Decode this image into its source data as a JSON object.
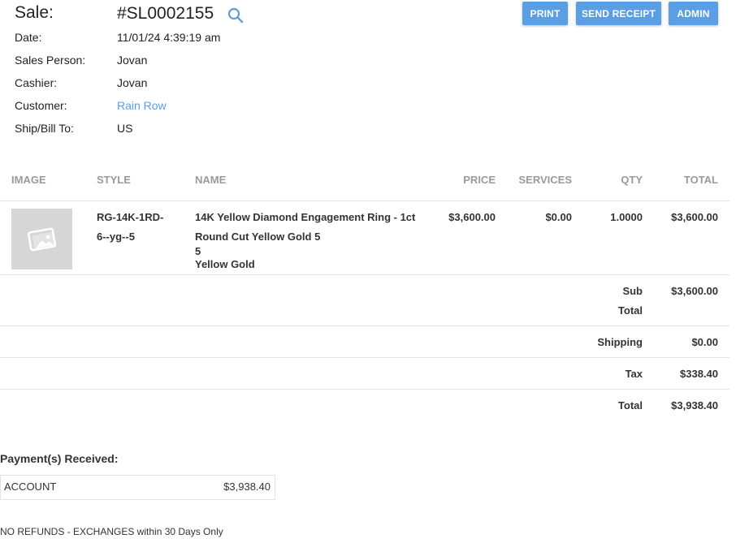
{
  "header": {
    "sale_label": "Sale:",
    "sale_number": "#SL0002155",
    "search_icon": "search-icon"
  },
  "info": {
    "date_label": "Date:",
    "date_value": "11/01/24 4:39:19 am",
    "sales_person_label": "Sales Person:",
    "sales_person_value": "Jovan",
    "cashier_label": "Cashier:",
    "cashier_value": "Jovan",
    "customer_label": "Customer:",
    "customer_value": "Rain Row",
    "ship_label": "Ship/Bill To:",
    "ship_value": "US"
  },
  "buttons": {
    "print": "PRINT",
    "send_receipt": "SEND RECEIPT",
    "admin": "ADMIN"
  },
  "table": {
    "headers": {
      "image": "IMAGE",
      "style": "STYLE",
      "name": "NAME",
      "price": "PRICE",
      "services": "SERVICES",
      "qty": "QTY",
      "total": "TOTAL"
    },
    "rows": [
      {
        "image_icon": "image-placeholder-icon",
        "style_line1": "RG-14K-1RD-",
        "style_line2": "6--yg--5",
        "name_line1": "14K Yellow Diamond Engagement Ring - 1ct",
        "name_line2": "Round Cut Yellow Gold 5",
        "name_line3": "5",
        "name_line4": "Yellow Gold",
        "price": "$3,600.00",
        "services": "$0.00",
        "qty": "1.0000",
        "total": "$3,600.00"
      }
    ]
  },
  "summary": {
    "subtotal_label_1": "Sub",
    "subtotal_label_2": "Total",
    "subtotal_value": "$3,600.00",
    "shipping_label": "Shipping",
    "shipping_value": "$0.00",
    "tax_label": "Tax",
    "tax_value": "$338.40",
    "total_label": "Total",
    "total_value": "$3,938.40"
  },
  "payments": {
    "title": "Payment(s) Received:",
    "items": [
      {
        "method": "ACCOUNT",
        "amount": "$3,938.40"
      }
    ]
  },
  "footer": {
    "policy": "NO REFUNDS - EXCHANGES within 30 Days Only"
  },
  "colors": {
    "button_bg": "#5a9fe6",
    "link": "#5aa0e0",
    "header_text": "#9a9a9a"
  }
}
